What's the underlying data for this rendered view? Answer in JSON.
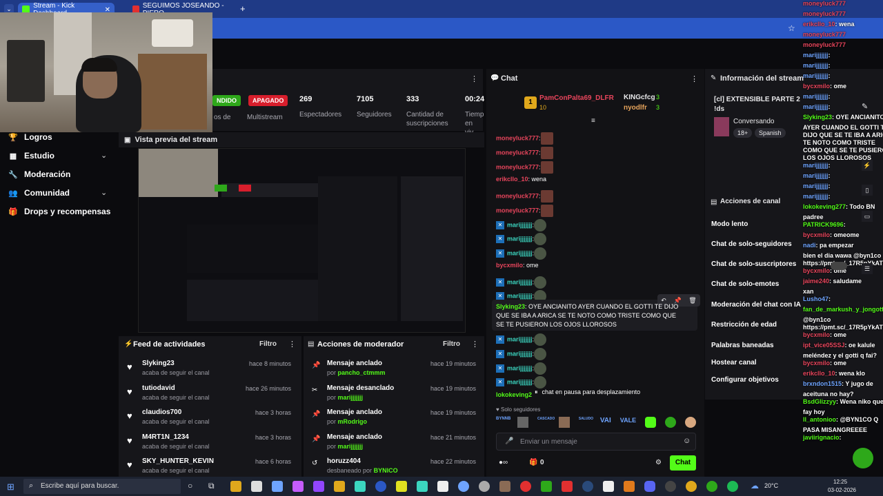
{
  "browser": {
    "tabs": [
      {
        "label": "Stream - Kick Dashboard",
        "color": "#53fc18"
      },
      {
        "label": "SEGUIMOS JOSEANDO - PIERO",
        "color": "#e23030"
      }
    ],
    "new_tab": "+"
  },
  "stats": {
    "status_badge": "NDIDO",
    "status_sub": "os de",
    "multistream_badge": "APAGADO",
    "multistream_label": "Multistream",
    "viewers": {
      "value": "269",
      "label": "Espectadores"
    },
    "followers": {
      "value": "7105",
      "label": "Seguidores"
    },
    "subs": {
      "value": "333",
      "label": "Cantidad de suscripciones"
    },
    "time": {
      "value": "00:24",
      "label": "Tiemp en viv"
    }
  },
  "nav": {
    "items": [
      {
        "label": "Logros",
        "icon": "trophy-icon"
      },
      {
        "label": "Estudio",
        "icon": "studio-icon",
        "chevron": true
      },
      {
        "label": "Moderación",
        "icon": "wrench-icon"
      },
      {
        "label": "Comunidad",
        "icon": "community-icon",
        "chevron": true
      },
      {
        "label": "Drops y recompensas",
        "icon": "gift-icon"
      }
    ]
  },
  "preview": {
    "title": "Vista previa del stream"
  },
  "feed": {
    "title": "Feed de actividades",
    "filter": "Filtro",
    "rows": [
      {
        "name": "Slyking23",
        "sub": "acaba de seguir el canal",
        "time": "hace 8 minutos"
      },
      {
        "name": "tutiodavid",
        "sub": "acaba de seguir el canal",
        "time": "hace 26 minutos"
      },
      {
        "name": "claudios700",
        "sub": "acaba de seguir el canal",
        "time": "hace 3 horas"
      },
      {
        "name": "M4RT1N_1234",
        "sub": "acaba de seguir el canal",
        "time": "hace 3 horas"
      },
      {
        "name": "SKY_HUNTER_KEVIN",
        "sub": "acaba de seguir el canal",
        "time": "hace 6 horas"
      }
    ]
  },
  "mod": {
    "title": "Acciones de moderador",
    "filter": "Filtro",
    "rows": [
      {
        "name": "Mensaje anclado",
        "by": "por",
        "user": "pancho_ctmmm",
        "time": "hace 19 minutos"
      },
      {
        "name": "Mensaje desanclado",
        "by": "por",
        "user": "marijjjjjjj",
        "time": "hace 19 minutos"
      },
      {
        "name": "Mensaje anclado",
        "by": "por",
        "user": "mRodrigo",
        "time": "hace 19 minutos"
      },
      {
        "name": "Mensaje anclado",
        "by": "por",
        "user": "marijjjjjjj",
        "time": "hace 21 minutos"
      },
      {
        "name": "horuzz404",
        "by": "desbaneado por",
        "user": "BYNICO",
        "time": "hace 22 minutos"
      }
    ]
  },
  "chat": {
    "title": "Chat",
    "top_gifter": {
      "rank": "1",
      "name": "PamConPalta69_DLFR",
      "count": "10"
    },
    "gifter2": {
      "name": "KINGcfcg",
      "count": "3"
    },
    "gifter3": {
      "name": "nyodlfr",
      "count": "3"
    },
    "messages": [
      {
        "user": "moneyluck777",
        "text": ":",
        "cls": "u-red",
        "emote": "red"
      },
      {
        "user": "moneyluck777",
        "text": ":",
        "cls": "u-red",
        "emote": "red"
      },
      {
        "user": "moneyluck777",
        "text": ":",
        "cls": "u-red",
        "emote": "red"
      },
      {
        "user": "erikcllo_10",
        "text": ": wena",
        "cls": "u-red",
        "emote": ""
      },
      {
        "user": "moneyluck777",
        "text": ":",
        "cls": "u-red",
        "emote": "red"
      },
      {
        "user": "moneyluck777",
        "text": ":",
        "cls": "u-red",
        "emote": "red"
      },
      {
        "user": "marijjjjjjj",
        "text": ":",
        "cls": "u-teal",
        "emote": "g",
        "badge": true
      },
      {
        "user": "marijjjjjjj",
        "text": ":",
        "cls": "u-teal",
        "emote": "g",
        "badge": true
      },
      {
        "user": "marijjjjjjj",
        "text": ":",
        "cls": "u-teal",
        "emote": "g",
        "badge": true
      },
      {
        "user": "bycxmilo",
        "text": ": ome",
        "cls": "u-red",
        "emote": ""
      },
      {
        "user": "marijjjjjjj",
        "text": ":",
        "cls": "u-teal",
        "emote": "g",
        "badge": true
      },
      {
        "user": "marijjjjjjj",
        "text": ":",
        "cls": "u-teal",
        "emote": "g",
        "badge": true
      }
    ],
    "pinned_user": "Slyking23",
    "pinned_text": ": OYE ANCIANITO AYER CUANDO EL GOTTI TE DIJO QUE SE IBA A ARICA SE TE NOTO COMO TRISTE COMO QUE SE TE PUSIERON LOS OJOS LLOROSOS",
    "after": [
      {
        "user": "marijjjjjjj",
        "text": ":"
      },
      {
        "user": "marijjjjjjj",
        "text": ":"
      },
      {
        "user": "marijjjjjjj",
        "text": ":"
      },
      {
        "user": "marijjjjjjj",
        "text": ":"
      }
    ],
    "last_user": "lokokeving2",
    "paused": "chat en pausa para desplazamiento",
    "followers_only": "Solo seguidores",
    "emotes": [
      "BYNNB",
      "",
      "CASCADO",
      "",
      "SALUDO",
      "VAI",
      "VALE",
      "",
      "",
      ""
    ],
    "placeholder": "Enviar un mensaje",
    "points": "0",
    "send": "Chat"
  },
  "info": {
    "title": "Información del stream",
    "stream_title": "[cl] EXTENSIBLE PARTE 2",
    "tag": "!ds",
    "category": "Conversando",
    "age": "18+",
    "lang": "Spanish"
  },
  "actions": {
    "title": "Acciones de canal",
    "items": [
      "Modo lento",
      "Chat de solo-seguidores",
      "Chat de solo-suscriptores",
      "Chat de solo-emotes",
      "Moderación del chat con IA",
      "Restricción de edad",
      "Palabras baneadas",
      "Hostear canal",
      "Configurar objetivos"
    ]
  },
  "overlay": [
    {
      "u": "moneyluck777",
      "t": "",
      "c": "n"
    },
    {
      "u": "moneyluck777",
      "t": "",
      "c": "n"
    },
    {
      "u": "erikcllo_10",
      "t": ": wena",
      "c": "n"
    },
    {
      "u": "moneyluck777",
      "t": "",
      "c": "n"
    },
    {
      "u": "moneyluck777",
      "t": "",
      "c": "n"
    },
    {
      "u": "marijjjjjjj",
      "t": ":",
      "c": "np"
    },
    {
      "u": "marijjjjjjj",
      "t": ":",
      "c": "np"
    },
    {
      "u": "marijjjjjjj",
      "t": ":",
      "c": "np"
    },
    {
      "u": "bycxmilo",
      "t": ": ome",
      "c": "n"
    },
    {
      "u": "marijjjjjjj",
      "t": ":",
      "c": "np"
    },
    {
      "u": "marijjjjjjj",
      "t": ":",
      "c": "np"
    },
    {
      "u": "Slyking23",
      "t": ": OYE ANCIANITO",
      "c": "nb"
    },
    {
      "u": "",
      "t": "AYER CUANDO EL GOTTI TE",
      "c": ""
    },
    {
      "u": "",
      "t": "DIJO QUE SE TE IBA A ARICA SE",
      "c": ""
    },
    {
      "u": "",
      "t": "TE NOTO COMO TRISTE",
      "c": ""
    },
    {
      "u": "",
      "t": "COMO QUE SE TE PUSIERON",
      "c": ""
    },
    {
      "u": "",
      "t": "LOS OJOS LLOROSOS",
      "c": ""
    },
    {
      "u": "marijjjjjjj",
      "t": ":",
      "c": "np"
    },
    {
      "u": "marijjjjjjj",
      "t": ":",
      "c": "np"
    },
    {
      "u": "marijjjjjjj",
      "t": ":",
      "c": "np"
    },
    {
      "u": "marijjjjjjj",
      "t": ":",
      "c": "np"
    },
    {
      "u": "lokokeving277",
      "t": ": Todo BN",
      "c": "nb"
    },
    {
      "u": "",
      "t": "padree",
      "c": ""
    },
    {
      "u": "PATRICK9696",
      "t": ":",
      "c": "nb"
    },
    {
      "u": "bycxmilo",
      "t": ": omeome",
      "c": "n"
    },
    {
      "u": "nadi",
      "t": ": pa empezar",
      "c": "np"
    },
    {
      "u": "",
      "t": "bien el dia wawa @byn1co",
      "c": ""
    },
    {
      "u": "",
      "t": "https://pmt.sc/_17R5pYkATVY",
      "c": ""
    },
    {
      "u": "bycxmilo",
      "t": ": ome",
      "c": "n"
    },
    {
      "u": "jaime240",
      "t": ": saludame",
      "c": "n"
    },
    {
      "u": "",
      "t": "xan",
      "c": ""
    },
    {
      "u": "Lusho47",
      "t": ":",
      "c": "np"
    },
    {
      "u": "fan_de_markush_y_jongotti",
      "t": ":",
      "c": "nb"
    },
    {
      "u": "",
      "t": "@byn1co",
      "c": ""
    },
    {
      "u": "",
      "t": "https://pmt.sc/_17R5pYkATVY",
      "c": ""
    },
    {
      "u": "bycxmilo",
      "t": ": ome",
      "c": "n"
    },
    {
      "u": "ipt_vice05SSJ",
      "t": ": oe kalule",
      "c": "n"
    },
    {
      "u": "",
      "t": "meléndez y el gotti q fai?",
      "c": ""
    },
    {
      "u": "bycxmilo",
      "t": ": ome",
      "c": "n"
    },
    {
      "u": "erikcllo_10",
      "t": ": wena klo",
      "c": "n"
    },
    {
      "u": "brxndon1515",
      "t": ": Y jugo de",
      "c": "np"
    },
    {
      "u": "",
      "t": "aceituna no hay?",
      "c": ""
    },
    {
      "u": "BsdGlizzyy",
      "t": ": Wena niko que",
      "c": "nb"
    },
    {
      "u": "",
      "t": "fay hoy",
      "c": ""
    },
    {
      "u": "ll_antonioo",
      "t": ": @BYN1CO Q",
      "c": "nb"
    },
    {
      "u": "",
      "t": "PASA MISANGREEEE",
      "c": ""
    },
    {
      "u": "javiirignacio",
      "t": ":",
      "c": "nb"
    }
  ],
  "taskbar": {
    "search": "Escribe aquí para buscar.",
    "temp": "20°C",
    "time": "12:25",
    "date": "03-02-2026"
  }
}
